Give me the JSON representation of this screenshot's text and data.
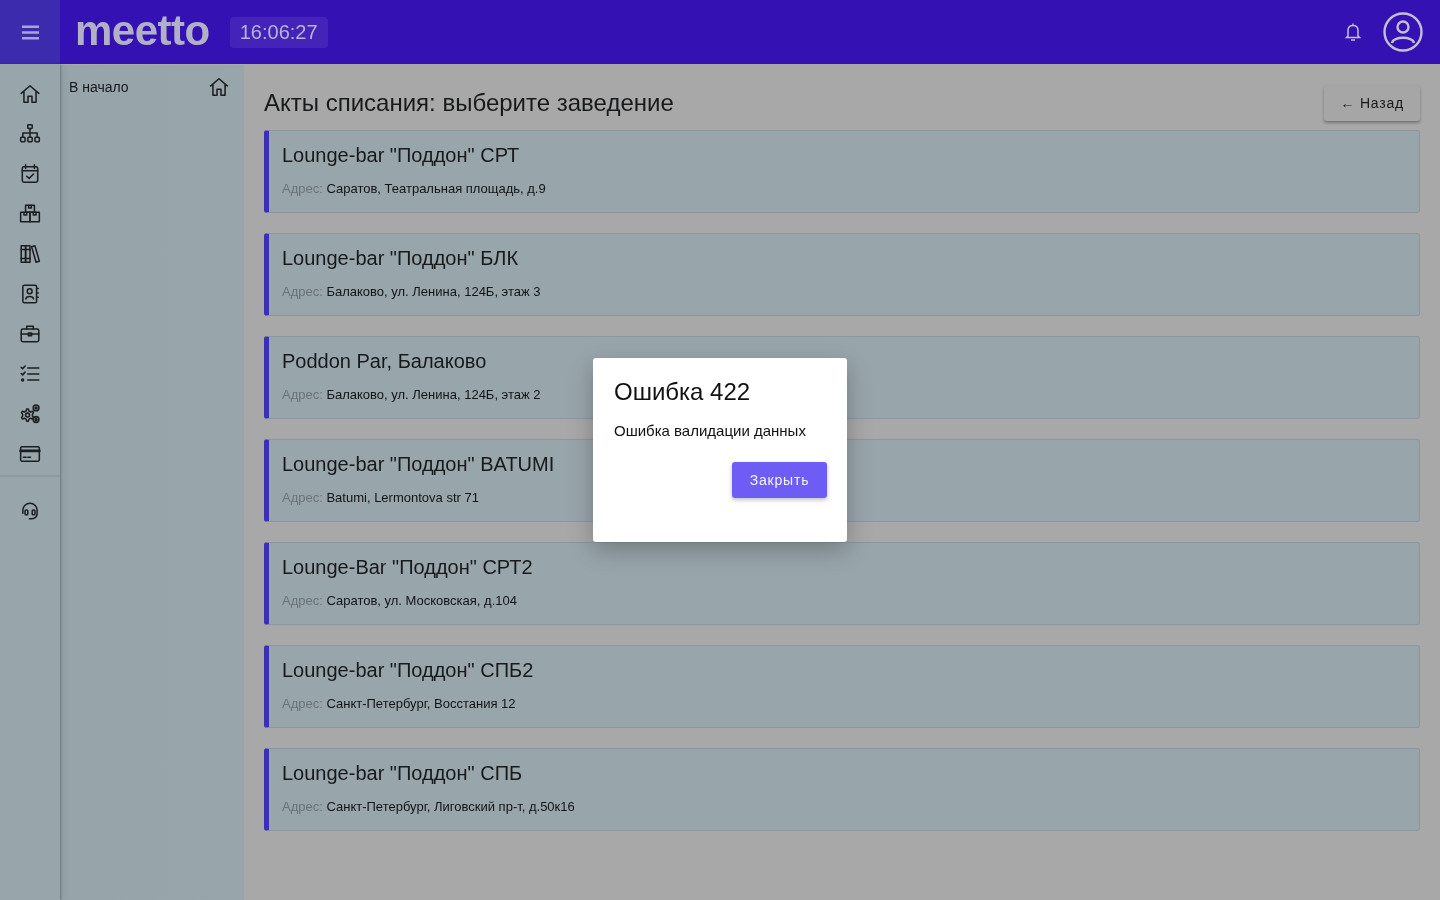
{
  "header": {
    "logo": "meetto",
    "time": "16:06:27"
  },
  "sidebar": {
    "items": [
      {
        "label": "В начало"
      }
    ]
  },
  "page": {
    "title": "Акты списания: выберите заведение",
    "back_button": "← Назад"
  },
  "venues": [
    {
      "name": "Lounge-bar \"Поддон\" СРТ",
      "address_label": "Адрес:",
      "address": "Саратов, Театральная площадь, д.9"
    },
    {
      "name": "Lounge-bar \"Поддон\" БЛК",
      "address_label": "Адрес:",
      "address": "Балаково, ул. Ленина, 124Б, этаж 3"
    },
    {
      "name": "Poddon Par, Балаково",
      "address_label": "Адрес:",
      "address": "Балаково, ул. Ленина, 124Б, этаж 2"
    },
    {
      "name": "Lounge-bar \"Поддон\" BATUMI",
      "address_label": "Адрес:",
      "address": "Batumi, Lermontova str 71"
    },
    {
      "name": "Lounge-Bar \"Поддон\" СРТ2",
      "address_label": "Адрес:",
      "address": "Саратов, ул. Московская, д.104"
    },
    {
      "name": "Lounge-bar \"Поддон\" СПБ2",
      "address_label": "Адрес:",
      "address": "Санкт-Петербург, Восстания 12"
    },
    {
      "name": "Lounge-bar \"Поддон\" СПБ",
      "address_label": "Адрес:",
      "address": "Санкт-Петербург, Лиговский пр-т, д.50к16"
    }
  ],
  "modal": {
    "title": "Ошибка 422",
    "message": "Ошибка валидации данных",
    "button": "Закрыть"
  }
}
